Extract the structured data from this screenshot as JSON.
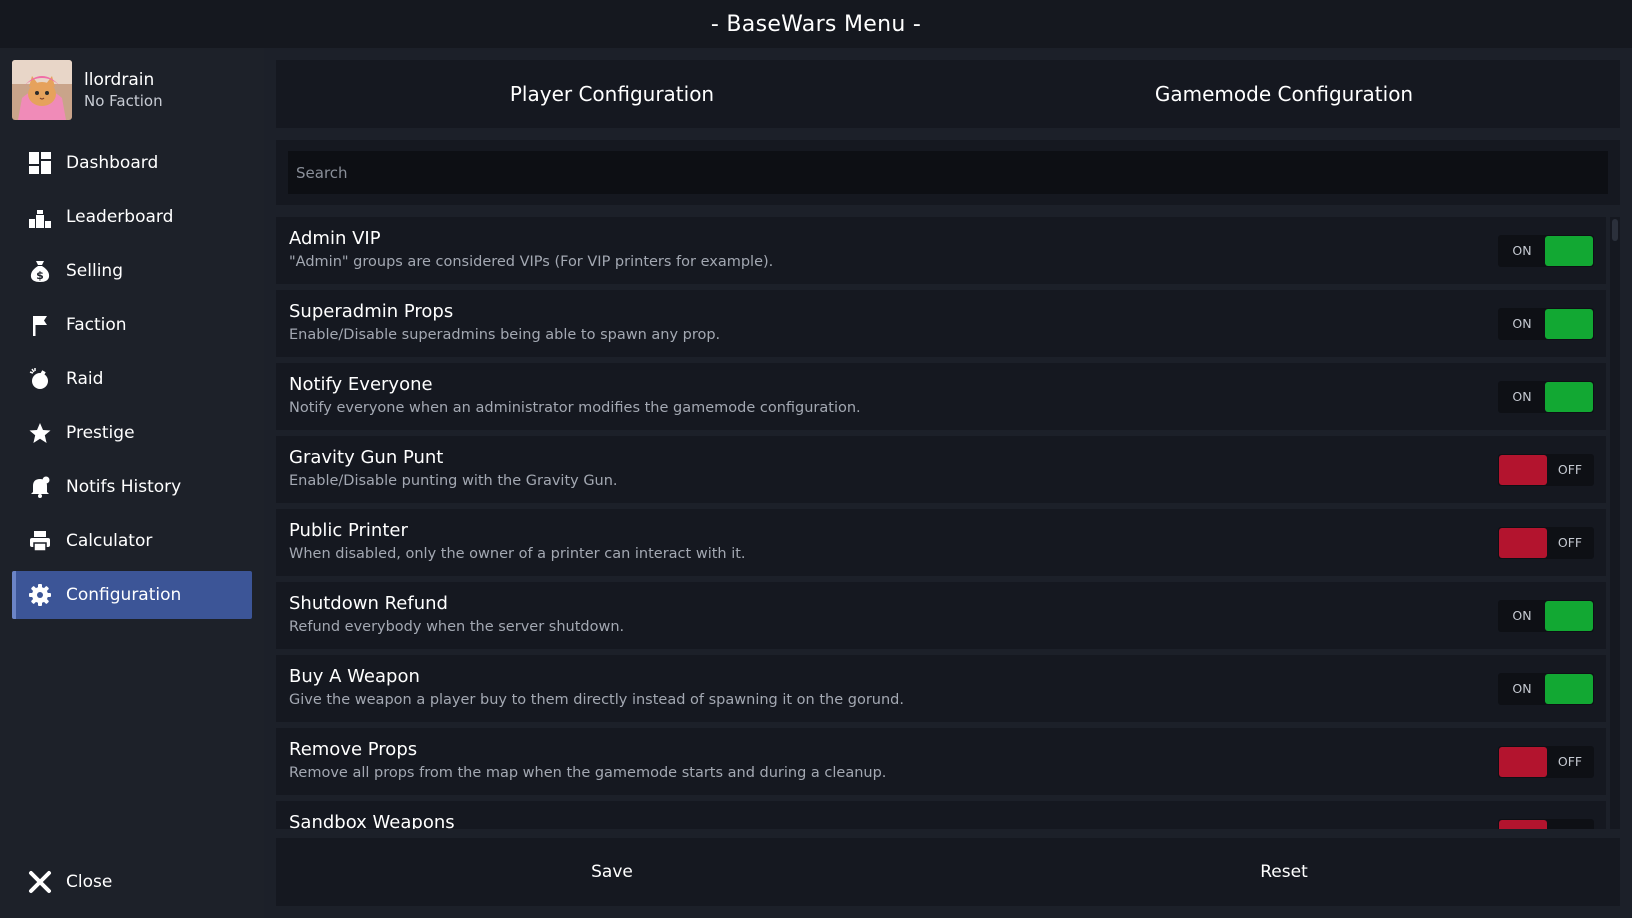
{
  "window": {
    "title": "- BaseWars Menu -"
  },
  "profile": {
    "name": "llordrain",
    "faction": "No Faction"
  },
  "nav": [
    {
      "label": "Dashboard",
      "icon": "dashboard-icon"
    },
    {
      "label": "Leaderboard",
      "icon": "podium-icon"
    },
    {
      "label": "Selling",
      "icon": "money-bag-icon"
    },
    {
      "label": "Faction",
      "icon": "flag-icon"
    },
    {
      "label": "Raid",
      "icon": "bomb-icon"
    },
    {
      "label": "Prestige",
      "icon": "star-icon"
    },
    {
      "label": "Notifs History",
      "icon": "bell-icon"
    },
    {
      "label": "Calculator",
      "icon": "printer-icon"
    },
    {
      "label": "Configuration",
      "icon": "gear-icon",
      "active": true
    }
  ],
  "close": {
    "label": "Close",
    "icon": "close-icon"
  },
  "tabs": [
    "Player Configuration",
    "Gamemode Configuration"
  ],
  "search": {
    "placeholder": "Search",
    "value": ""
  },
  "settings": [
    {
      "title": "Admin VIP",
      "desc": "\"Admin\" groups are considered VIPs (For VIP printers for example).",
      "state": "on"
    },
    {
      "title": "Superadmin Props",
      "desc": "Enable/Disable superadmins being able to spawn any prop.",
      "state": "on"
    },
    {
      "title": "Notify Everyone",
      "desc": "Notify everyone when an administrator modifies the gamemode configuration.",
      "state": "on"
    },
    {
      "title": "Gravity Gun Punt",
      "desc": "Enable/Disable punting with the Gravity Gun.",
      "state": "off"
    },
    {
      "title": "Public Printer",
      "desc": "When disabled, only the owner of a printer can interact with it.",
      "state": "off"
    },
    {
      "title": "Shutdown Refund",
      "desc": "Refund everybody when the server shutdown.",
      "state": "on"
    },
    {
      "title": "Buy A Weapon",
      "desc": "Give the weapon a player buy to them directly instead of spawning it on the gorund.",
      "state": "on"
    },
    {
      "title": "Remove Props",
      "desc": "Remove all props from the map when the gamemode starts and during a cleanup.",
      "state": "off"
    },
    {
      "title": "Sandbox Weapons",
      "desc": "",
      "state": "off"
    }
  ],
  "toggle_labels": {
    "on": "ON",
    "off": "OFF"
  },
  "actions": {
    "save": "Save",
    "reset": "Reset"
  },
  "colors": {
    "on": "#12a833",
    "off": "#b3142e",
    "active_nav": "#3c5597",
    "panel": "#151820",
    "background": "#1c2029"
  }
}
